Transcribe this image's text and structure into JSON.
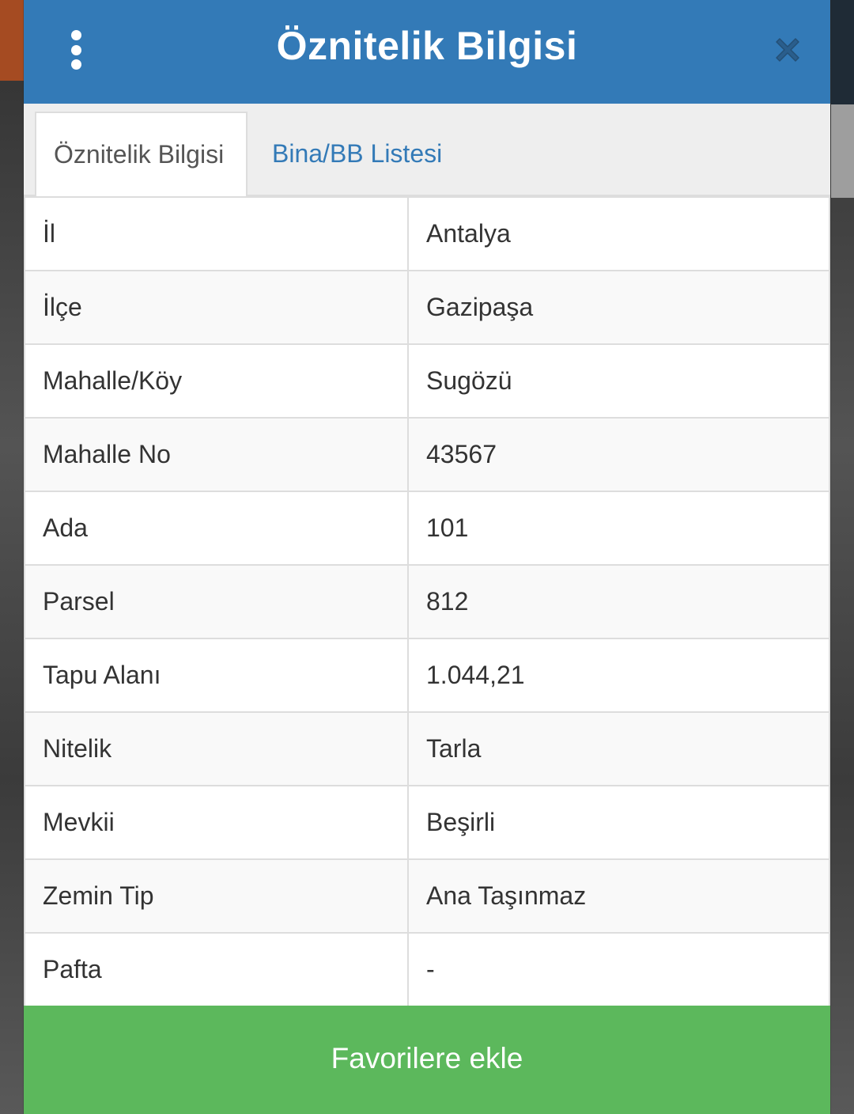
{
  "header": {
    "title": "Öznitelik Bilgisi"
  },
  "icons": {
    "menu": "vertical-dots-icon",
    "close": "close-icon"
  },
  "tabs": [
    {
      "label": "Öznitelik Bilgisi",
      "active": true
    },
    {
      "label": "Bina/BB Listesi",
      "active": false
    }
  ],
  "attributes": [
    {
      "key": "İl",
      "value": "Antalya"
    },
    {
      "key": "İlçe",
      "value": "Gazipaşa"
    },
    {
      "key": "Mahalle/Köy",
      "value": "Sugözü"
    },
    {
      "key": "Mahalle No",
      "value": "43567"
    },
    {
      "key": "Ada",
      "value": "101"
    },
    {
      "key": "Parsel",
      "value": "812"
    },
    {
      "key": "Tapu Alanı",
      "value": "1.044,21"
    },
    {
      "key": "Nitelik",
      "value": "Tarla"
    },
    {
      "key": "Mevkii",
      "value": "Beşirli"
    },
    {
      "key": "Zemin Tip",
      "value": "Ana Taşınmaz"
    },
    {
      "key": "Pafta",
      "value": "-"
    }
  ],
  "footer": {
    "favorite_label": "Favorilere ekle"
  },
  "colors": {
    "header_bg": "#337ab7",
    "tab_link": "#337ab7",
    "button_bg": "#5cb85c",
    "close_icon": "#2a5e8c"
  }
}
